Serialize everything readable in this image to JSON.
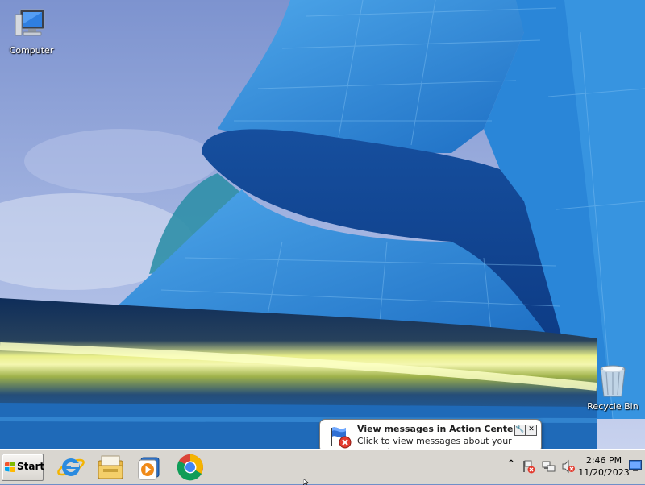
{
  "desktop": {
    "icons": [
      {
        "label": "Computer",
        "icon": "computer-icon"
      },
      {
        "label": "Recycle Bin",
        "icon": "recycle-bin-icon"
      }
    ]
  },
  "notification": {
    "title": "View messages in Action Center",
    "text": "Click to view messages about your computer.",
    "icon": "action-center-flag-icon",
    "options_glyph": "🔧",
    "close_glyph": "✕"
  },
  "taskbar": {
    "start_label": "Start",
    "pinned": [
      {
        "name": "Internet Explorer",
        "icon": "internet-explorer-icon"
      },
      {
        "name": "Windows Explorer",
        "icon": "file-explorer-icon"
      },
      {
        "name": "Windows Media Player",
        "icon": "media-player-icon"
      },
      {
        "name": "Google Chrome",
        "icon": "chrome-icon"
      }
    ],
    "tray": {
      "expand_glyph": "^",
      "icons": [
        "action-center-icon",
        "network-icon",
        "volume-icon"
      ]
    },
    "clock": {
      "time": "2:46 PM",
      "date": "11/20/2023"
    }
  },
  "colors": {
    "sky": "#8aa3d6",
    "building_blue": "#2f86d6",
    "taskbar": "#d9d6d0",
    "balloon_bg": "#fffffe"
  }
}
